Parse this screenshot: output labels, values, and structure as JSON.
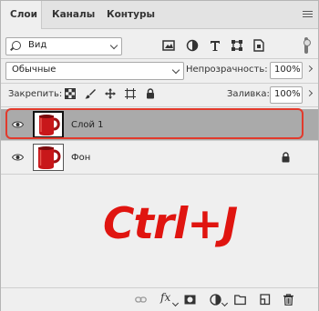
{
  "tabs": [
    {
      "label": "Слои",
      "active": true
    },
    {
      "label": "Каналы",
      "active": false
    },
    {
      "label": "Контуры",
      "active": false
    }
  ],
  "filter": {
    "kind_label": "Вид"
  },
  "blend": {
    "mode": "Обычные",
    "opacity_label": "Непрозрачность:",
    "opacity_value": "100%"
  },
  "lock": {
    "label": "Закрепить:",
    "fill_label": "Заливка:",
    "fill_value": "100%"
  },
  "layers": [
    {
      "name": "Слой 1",
      "selected": true,
      "locked": false
    },
    {
      "name": "Фон",
      "selected": false,
      "locked": true
    }
  ],
  "overlay_text": "Ctrl+J",
  "colors": {
    "accent_outline": "#e23a2c",
    "overlay_text": "#e01510",
    "selected_row": "#aaaaaa"
  }
}
